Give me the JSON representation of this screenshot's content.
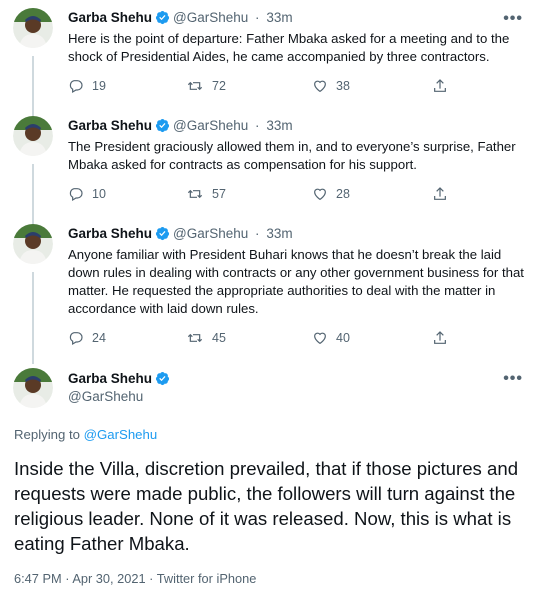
{
  "tweets": [
    {
      "name": "Garba Shehu",
      "handle": "@GarShehu",
      "sep": "·",
      "time": "33m",
      "more": "•••",
      "text": "Here is the point of departure: Father Mbaka asked for a meeting and to the shock of Presidential Aides, he came accompanied by three contractors.",
      "replies": "19",
      "retweets": "72",
      "likes": "38"
    },
    {
      "name": "Garba Shehu",
      "handle": "@GarShehu",
      "sep": "·",
      "time": "33m",
      "more": "•••",
      "text": "The President graciously allowed them in, and to everyone’s surprise, Father Mbaka asked for contracts as compensation for his support.",
      "replies": "10",
      "retweets": "57",
      "likes": "28"
    },
    {
      "name": "Garba Shehu",
      "handle": "@GarShehu",
      "sep": "·",
      "time": "33m",
      "more": "•••",
      "text": "Anyone familiar with President Buhari knows that he doesn’t break the laid down rules in dealing with contracts or any other government business for that matter. He requested the appropriate authorities to deal with the matter in accordance with laid down rules.",
      "replies": "24",
      "retweets": "45",
      "likes": "40"
    }
  ],
  "main_tweet": {
    "name": "Garba Shehu",
    "handle": "@GarShehu",
    "more": "•••",
    "replying_prefix": "Replying to",
    "replying_handle": "@GarShehu",
    "text": "Inside the Villa, discretion prevailed, that if those pictures and requests were made public, the followers will turn against the religious leader. None of it was released. Now, this is what is eating Father Mbaka.",
    "meta": "6:47 PM · Apr 30, 2021 · Twitter for iPhone"
  },
  "colors": {
    "verified": "#1d9bf0",
    "secondary_text": "#536471",
    "link": "#1d9bf0"
  }
}
